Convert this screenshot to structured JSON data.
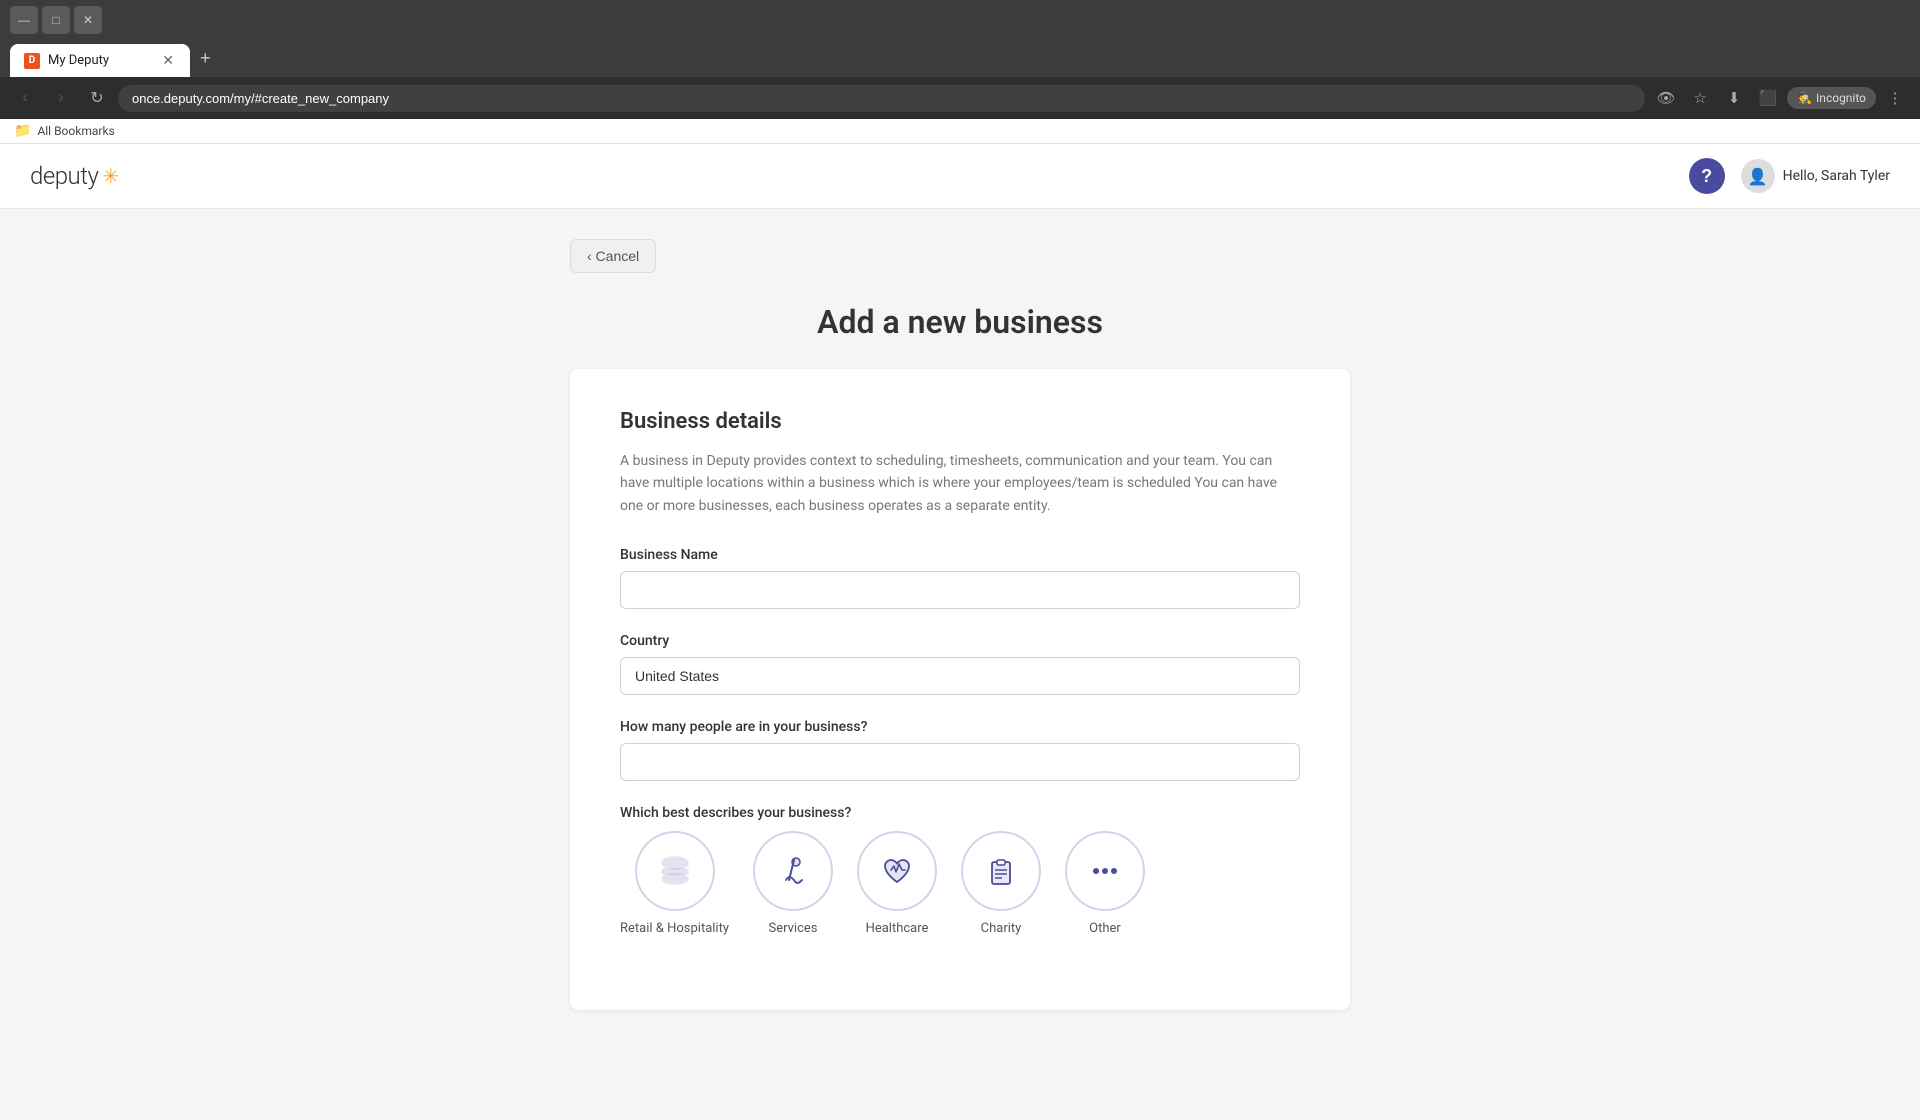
{
  "browser": {
    "tab_title": "My Deputy",
    "tab_favicon": "D",
    "new_tab_label": "+",
    "address_bar_value": "once.deputy.com/my/#create_new_company",
    "nav_back": "‹",
    "nav_forward": "›",
    "nav_refresh": "↻",
    "incognito_label": "Incognito",
    "bookmarks_label": "All Bookmarks"
  },
  "app": {
    "logo_text": "deputy",
    "logo_star": "✳",
    "help_label": "?",
    "user_greeting": "Hello, Sarah Tyler"
  },
  "page": {
    "page_title": "Add a new business",
    "cancel_label": "‹  Cancel",
    "form": {
      "section_title": "Business details",
      "section_desc": "A business in Deputy provides context to scheduling, timesheets, communication and your team. You can have multiple locations within a business which is where your employees/team is scheduled You can have one or more businesses, each business operates as a separate entity.",
      "business_name_label": "Business Name",
      "business_name_placeholder": "",
      "country_label": "Country",
      "country_value": "United States",
      "people_label": "How many people are in your business?",
      "people_placeholder": "",
      "type_label": "Which best describes your business?",
      "business_types": [
        {
          "id": "retail",
          "label": "Retail & Hospitality",
          "icon": "🍔"
        },
        {
          "id": "services",
          "label": "Services",
          "icon": "🧹"
        },
        {
          "id": "healthcare",
          "label": "Healthcare",
          "icon": "❤️"
        },
        {
          "id": "charity",
          "label": "Charity",
          "icon": "📋"
        },
        {
          "id": "other",
          "label": "Other",
          "icon": "···"
        }
      ]
    }
  },
  "colors": {
    "accent": "#4a4a9e",
    "logo_star": "#f5a623"
  }
}
